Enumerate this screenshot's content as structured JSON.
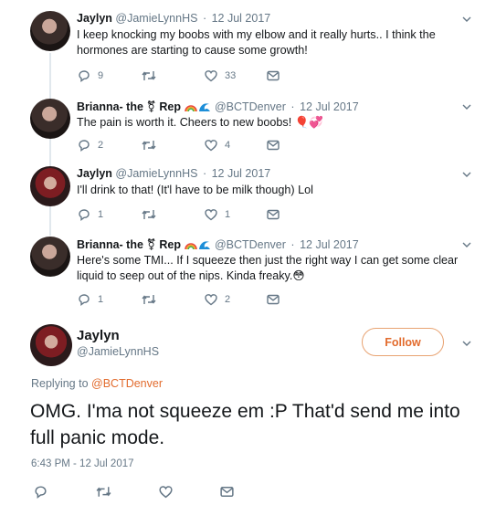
{
  "tweets": [
    {
      "name": "Jaylyn",
      "handle": "@JamieLynnHS",
      "sep": "·",
      "date": "12 Jul 2017",
      "text": "I keep knocking my boobs with my elbow and it really hurts.. I think the hormones are starting to cause some growth!",
      "replies": "9",
      "retweets": "",
      "likes": "33"
    },
    {
      "name": "Brianna- the ⚧ Rep",
      "handle": "@BCTDenver",
      "sep": "·",
      "date": "12 Jul 2017",
      "text": "The pain is worth it. Cheers to new boobs! 🎈💞",
      "replies": "2",
      "retweets": "",
      "likes": "4"
    },
    {
      "name": "Jaylyn",
      "handle": "@JamieLynnHS",
      "sep": "·",
      "date": "12 Jul 2017",
      "text": "I'll drink to that! (It'l have to be milk though) Lol",
      "replies": "1",
      "retweets": "",
      "likes": "1"
    },
    {
      "name": "Brianna- the ⚧ Rep",
      "handle": "@BCTDenver",
      "sep": "·",
      "date": "12 Jul 2017",
      "text": "Here's some TMI... If I squeeze then just the right way I can get some clear liquid to seep out of the nips. Kinda freaky.😳",
      "replies": "1",
      "retweets": "",
      "likes": "2"
    }
  ],
  "main": {
    "name": "Jaylyn",
    "handle": "@JamieLynnHS",
    "follow_label": "Follow",
    "replying_prefix": "Replying to ",
    "replying_to": "@BCTDenver",
    "text": "OMG. I'ma not squeeze em :P That'd send me into full panic mode.",
    "timestamp": "6:43 PM - 12 Jul 2017"
  },
  "icons": {
    "reply": "reply-icon",
    "retweet": "retweet-icon",
    "like": "heart-icon",
    "dm": "envelope-icon",
    "caret": "chevron-down-icon"
  },
  "colors": {
    "accent": "#e26b2d",
    "muted": "#657786",
    "text": "#14171a"
  }
}
